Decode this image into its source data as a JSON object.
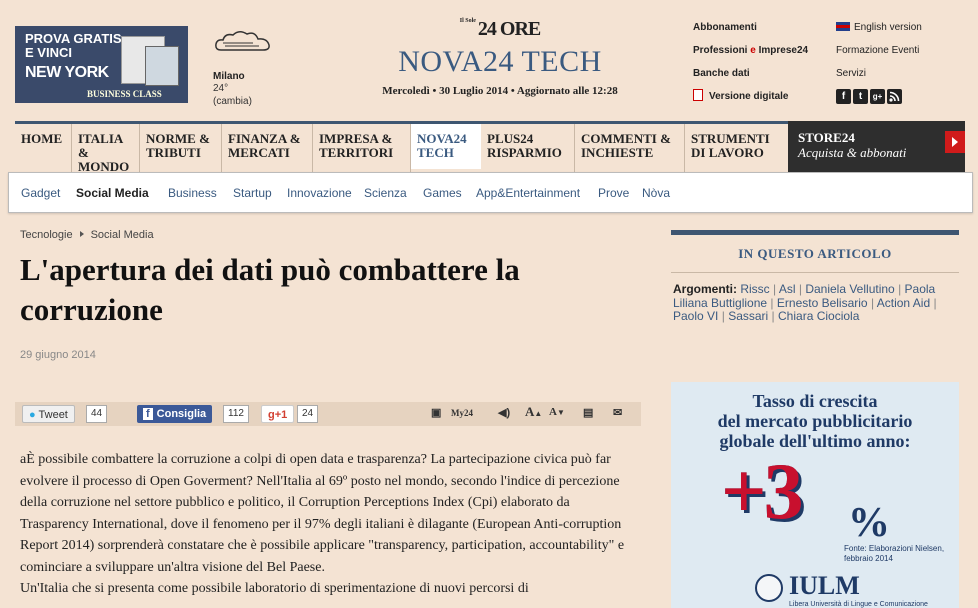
{
  "promo": {
    "line1": "PROVA GRATIS",
    "line2": "E VINCI",
    "line3": "NEW YORK",
    "line4": "BUSINESS CLASS"
  },
  "weather": {
    "icon": "cloud-icon",
    "city": "Milano",
    "temp": "24°",
    "change": "(cambia)"
  },
  "logo": {
    "prefix": "Il Sole",
    "name": "24 ORE",
    "section": "NOVA24 TECH",
    "date": "Mercoledì  •  30 Luglio 2014  •  Aggiornato alle 12:28"
  },
  "header_links": {
    "col1": [
      {
        "label": "Abbonamenti"
      },
      {
        "label_a": "Professioni",
        "label_e": " e ",
        "label_b": "Imprese24"
      },
      {
        "label": "Banche dati"
      },
      {
        "label": "Versione digitale",
        "icon": "pdf-icon"
      }
    ],
    "col2": [
      {
        "label": "English version",
        "icon": "uk-flag-icon"
      },
      {
        "label": "Formazione Eventi"
      },
      {
        "label": "Servizi"
      }
    ],
    "social": [
      "f",
      "t",
      "g+",
      "rss"
    ]
  },
  "main_nav": [
    {
      "l1": "HOME",
      "l2": ""
    },
    {
      "l1": "ITALIA &",
      "l2": "MONDO"
    },
    {
      "l1": "NORME &",
      "l2": "TRIBUTI"
    },
    {
      "l1": "FINANZA &",
      "l2": "MERCATI"
    },
    {
      "l1": "IMPRESA &",
      "l2": "TERRITORI"
    },
    {
      "l1": "NOVA24",
      "l2": "TECH"
    },
    {
      "l1": "PLUS24",
      "l2": "RISPARMIO"
    },
    {
      "l1": "COMMENTI &",
      "l2": "INCHIESTE"
    },
    {
      "l1": "STRUMENTI",
      "l2": "DI LAVORO"
    }
  ],
  "store": {
    "l1": "STORE24",
    "l2": "Acquista & abbonati"
  },
  "sub_nav": [
    "Gadget",
    "Social Media",
    "Business",
    "Startup",
    "Innovazione",
    "Scienza",
    "Games",
    "App&Entertainment",
    "Prove",
    "Nòva"
  ],
  "breadcrumb": {
    "c1": "Tecnologie",
    "c2": "Social Media"
  },
  "article": {
    "title": "L'apertura dei dati può combattere la corruzione",
    "date": "29 giugno 2014",
    "body": "aÈ possibile combattere la corruzione a colpi di open data e trasparenza? La partecipazione civica può far evolvere il processo di Open Goverment? Nell'Italia al 69º posto nel mondo, secondo l'indice di percezione della corruzione nel settore pubblico e politico, il Corruption Perceptions Index (Cpi) elaborato da Trasparency International, dove il fenomeno per il 97% degli italiani è dilagante (European Anti-corruption Report 2014) sorprenderà constatare che è possibile applicare \"transparency, participation, accountability\" e cominciare a sviluppare un'altra visione del Bel Paese.",
    "body2": "Un'Italia che si presenta come possibile laboratorio di sperimentazione di nuovi percorsi di"
  },
  "share": {
    "tweet": "Tweet",
    "tweet_count": "44",
    "like": "Consiglia",
    "like_count": "112",
    "gplus": "g+1",
    "gplus_count": "24",
    "my24": "My24",
    "font_up": "A",
    "font_down": "A"
  },
  "sidebar": {
    "title": "IN QUESTO ARTICOLO",
    "tags_label": "Argomenti:",
    "tags": [
      "Rissc",
      "Asl",
      "Daniela Vellutino",
      "Paola Liliana Buttiglione",
      "Ernesto Belisario",
      "Action Aid",
      "Paolo VI",
      "Sassari",
      "Chiara Ciociola"
    ]
  },
  "ad": {
    "headline1": "Tasso di crescita",
    "headline2": "del mercato pubblicitario",
    "headline3": "globale dell'ultimo anno:",
    "big": "+3",
    "pct": "%",
    "source1": "Fonte: Elaborazioni Nielsen,",
    "source2": "febbraio 2014",
    "brand": "IULM",
    "tagline": "Libera Università di Lingue e Comunicazione"
  },
  "colors": {
    "bg": "#f4e3d3",
    "navy": "#3e5671",
    "link": "#3a5a80",
    "red": "#c8102e"
  }
}
